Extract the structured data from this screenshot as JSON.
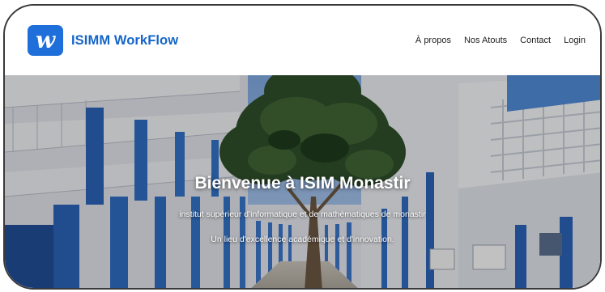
{
  "navbar": {
    "logo_letter": "w",
    "brand": "ISIMM WorkFlow",
    "links": [
      "À propos",
      "Nos Atouts",
      "Contact",
      "Login"
    ]
  },
  "hero": {
    "title": "Bienvenue à ISIM Monastir",
    "subtitle": "institut supérieur d'informatique et de mathématiques de monastir",
    "tagline": "Un lieu d'excellence académique et d'innovation."
  },
  "colors": {
    "brand_blue": "#1565c8",
    "logo_bg": "#1e6fd9",
    "column_blue": "#2b63b8"
  }
}
